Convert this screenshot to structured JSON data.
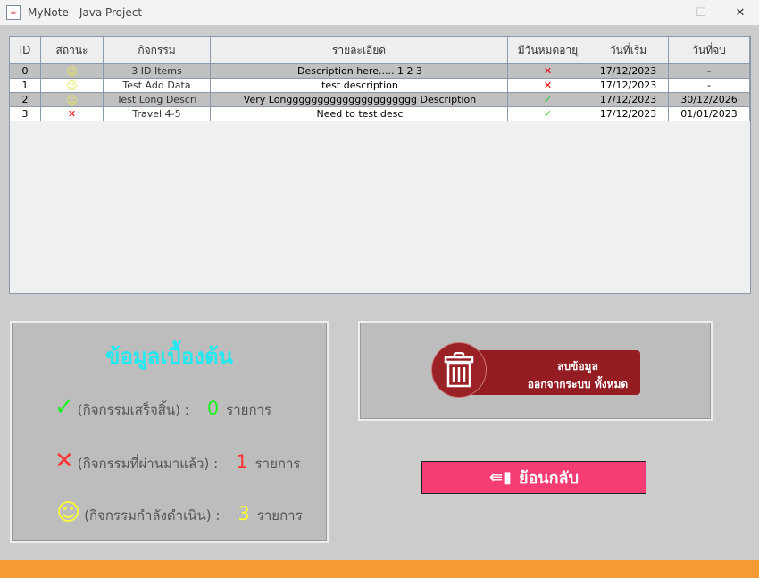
{
  "window": {
    "title": "MyNote - Java Project",
    "minimize": "—",
    "maximize": "☐",
    "close": "✕"
  },
  "table": {
    "headers": [
      "ID",
      "สถานะ",
      "กิจกรรม",
      "รายละเอียด",
      "มีวันหมดอายุ",
      "วันที่เริ่ม",
      "วันที่จบ"
    ],
    "rows": [
      {
        "id": "0",
        "status": "☺",
        "activity": "3 ID Items",
        "detail": "Description here..... 1 2 3",
        "expire": "✕",
        "start": "17/12/2023",
        "end": "-"
      },
      {
        "id": "1",
        "status": "☺",
        "activity": "Test Add Data",
        "detail": "test description",
        "expire": "✕",
        "start": "17/12/2023",
        "end": "-"
      },
      {
        "id": "2",
        "status": "☺",
        "activity": "Test Long Descri",
        "detail": "Very Longgggggggggggggggggggg Description",
        "expire": "✓",
        "start": "17/12/2023",
        "end": "30/12/2026"
      },
      {
        "id": "3",
        "status": "✕",
        "activity": "Travel 4-5",
        "detail": "Need to test desc",
        "expire": "✓",
        "start": "17/12/2023",
        "end": "01/01/2023"
      }
    ]
  },
  "stats": {
    "title": "ข้อมูลเบื้องต้น",
    "items": [
      {
        "icon": "✓",
        "label": "(กิจกรรมเสร็จสิ้น) :",
        "count": "0",
        "unit": "รายการ",
        "color": "#22ee22"
      },
      {
        "icon": "✕",
        "label": "(กิจกรรมที่ผ่านมาแล้ว) :",
        "count": "1",
        "unit": "รายการ",
        "color": "#ff3333"
      },
      {
        "icon": "☺",
        "label": "(กิจกรรมกำลังดำเนิน) :",
        "count": "3",
        "unit": "รายการ",
        "color": "#ffff33"
      }
    ]
  },
  "delete": {
    "line1": "ลบข้อมูล",
    "line2": "ออกจากระบบ ทั้งหมด"
  },
  "back": {
    "label": "ย้อนกลับ"
  }
}
